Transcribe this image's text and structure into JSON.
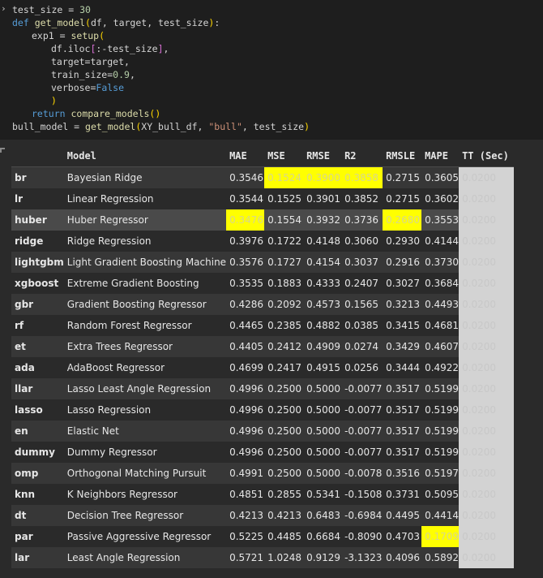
{
  "code": {
    "line1": {
      "var": "test_size",
      "op": " = ",
      "val": "30"
    },
    "line2": {
      "kw": "def",
      "fn": "get_model",
      "args": "df, target, test_size"
    },
    "line3": {
      "var": "exp1",
      "op": " = ",
      "fn": "setup"
    },
    "line4": {
      "pre": "df.iloc",
      "slice": ":-test_size"
    },
    "line5": {
      "text": "target=target,"
    },
    "line6": {
      "pre": "train_size=",
      "val": "0.9",
      "post": ","
    },
    "line7": {
      "pre": "verbose=",
      "val": "False"
    },
    "line8": {
      "text": ")"
    },
    "line9": {
      "kw": "return",
      "fn": "compare_models",
      "parens": "()"
    },
    "line10": {
      "pre": "bull_model = ",
      "fn": "get_model",
      "a1": "XY_bull_df, ",
      "str": "\"bull\"",
      "a2": ", test_size"
    }
  },
  "table": {
    "headers": [
      "",
      "Model",
      "MAE",
      "MSE",
      "RMSE",
      "R2",
      "RMSLE",
      "MAPE",
      "TT (Sec)"
    ],
    "rows": [
      [
        "br",
        "Bayesian Ridge",
        "0.3546",
        "0.1524",
        "0.3900",
        "0.3858",
        "0.2715",
        "0.3605",
        "0.0200"
      ],
      [
        "lr",
        "Linear Regression",
        "0.3544",
        "0.1525",
        "0.3901",
        "0.3852",
        "0.2715",
        "0.3602",
        "0.0200"
      ],
      [
        "huber",
        "Huber Regressor",
        "0.3476",
        "0.1554",
        "0.3932",
        "0.3736",
        "0.2680",
        "0.3553",
        "0.0200"
      ],
      [
        "ridge",
        "Ridge Regression",
        "0.3976",
        "0.1722",
        "0.4148",
        "0.3060",
        "0.2930",
        "0.4144",
        "0.0200"
      ],
      [
        "lightgbm",
        "Light Gradient Boosting Machine",
        "0.3576",
        "0.1727",
        "0.4154",
        "0.3037",
        "0.2916",
        "0.3730",
        "0.0200"
      ],
      [
        "xgboost",
        "Extreme Gradient Boosting",
        "0.3535",
        "0.1883",
        "0.4333",
        "0.2407",
        "0.3027",
        "0.3684",
        "0.0200"
      ],
      [
        "gbr",
        "Gradient Boosting Regressor",
        "0.4286",
        "0.2092",
        "0.4573",
        "0.1565",
        "0.3213",
        "0.4493",
        "0.0200"
      ],
      [
        "rf",
        "Random Forest Regressor",
        "0.4465",
        "0.2385",
        "0.4882",
        "0.0385",
        "0.3415",
        "0.4681",
        "0.0200"
      ],
      [
        "et",
        "Extra Trees Regressor",
        "0.4405",
        "0.2412",
        "0.4909",
        "0.0274",
        "0.3429",
        "0.4607",
        "0.0200"
      ],
      [
        "ada",
        "AdaBoost Regressor",
        "0.4699",
        "0.2417",
        "0.4915",
        "0.0256",
        "0.3444",
        "0.4922",
        "0.0200"
      ],
      [
        "llar",
        "Lasso Least Angle Regression",
        "0.4996",
        "0.2500",
        "0.5000",
        "-0.0077",
        "0.3517",
        "0.5199",
        "0.0200"
      ],
      [
        "lasso",
        "Lasso Regression",
        "0.4996",
        "0.2500",
        "0.5000",
        "-0.0077",
        "0.3517",
        "0.5199",
        "0.0200"
      ],
      [
        "en",
        "Elastic Net",
        "0.4996",
        "0.2500",
        "0.5000",
        "-0.0077",
        "0.3517",
        "0.5199",
        "0.0200"
      ],
      [
        "dummy",
        "Dummy Regressor",
        "0.4996",
        "0.2500",
        "0.5000",
        "-0.0077",
        "0.3517",
        "0.5199",
        "0.0200"
      ],
      [
        "omp",
        "Orthogonal Matching Pursuit",
        "0.4991",
        "0.2500",
        "0.5000",
        "-0.0078",
        "0.3516",
        "0.5197",
        "0.0200"
      ],
      [
        "knn",
        "K Neighbors Regressor",
        "0.4851",
        "0.2855",
        "0.5341",
        "-0.1508",
        "0.3731",
        "0.5095",
        "0.0200"
      ],
      [
        "dt",
        "Decision Tree Regressor",
        "0.4213",
        "0.4213",
        "0.6483",
        "-0.6984",
        "0.4495",
        "0.4414",
        "0.0200"
      ],
      [
        "par",
        "Passive Aggressive Regressor",
        "0.5225",
        "0.4485",
        "0.6684",
        "-0.8090",
        "0.4703",
        "0.1709",
        "0.0200"
      ],
      [
        "lar",
        "Least Angle Regression",
        "0.5721",
        "1.0248",
        "0.9129",
        "-3.1323",
        "0.4096",
        "0.5892",
        "0.0200"
      ]
    ],
    "highlights": [
      [
        0,
        3
      ],
      [
        0,
        4
      ],
      [
        0,
        5
      ],
      [
        2,
        2
      ],
      [
        2,
        6
      ],
      [
        17,
        7
      ]
    ],
    "highlight_color": "#ffff00",
    "tt_color": "#d3d3d3",
    "hover_row": 2
  }
}
